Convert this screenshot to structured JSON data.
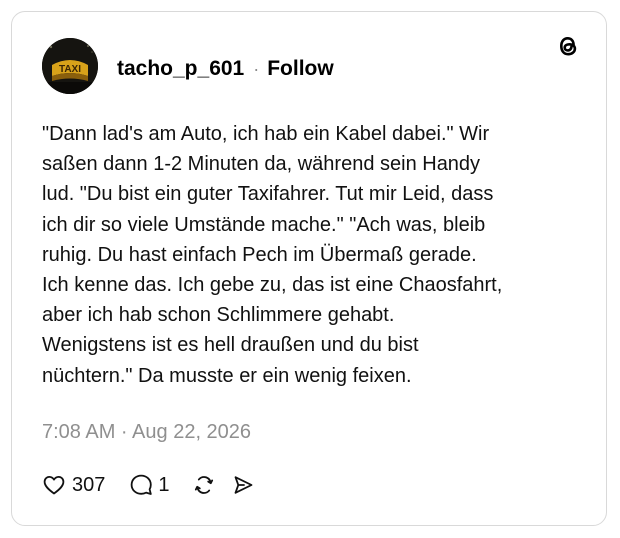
{
  "post": {
    "username": "tacho_p_601",
    "separator": "·",
    "follow_label": "Follow",
    "avatar_sign_text": "TAXI",
    "text": "\"Dann lad's am Auto, ich hab ein Kabel dabei.\" Wir\nsaßen dann 1-2 Minuten da, während sein Handy\nlud. \"Du bist ein guter Taxifahrer. Tut mir Leid, dass\nich dir so viele Umstände mache.\" \"Ach was, bleib\nruhig. Du hast einfach Pech im Übermaß gerade.\nIch kenne das. Ich gebe zu, das ist eine Chaosfahrt,\naber ich hab schon Schlimmere gehabt.\nWenigstens ist es hell draußen und du bist\nnüchtern.\" Da musste er ein wenig feixen.",
    "timestamp": "7:08 AM · Aug 22, 2026"
  },
  "actions": {
    "likes": "307",
    "replies": "1",
    "like_icon": "heart-icon",
    "reply_icon": "comment-icon",
    "repost_icon": "repost-icon",
    "share_icon": "share-icon"
  },
  "brand": {
    "logo_icon": "threads-logo-icon",
    "text_color": "#111111",
    "muted_color": "#8f8f8f",
    "border_color": "#d9d9d9",
    "taxi_sign_color": "#d8a21a"
  }
}
